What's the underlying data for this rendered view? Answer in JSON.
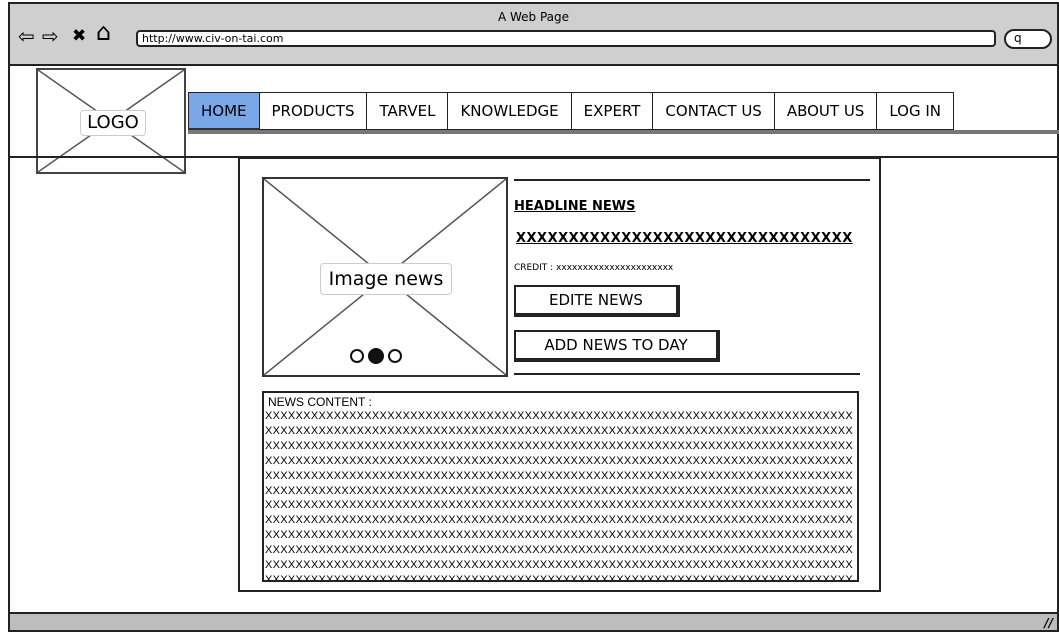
{
  "window": {
    "title": "A Web Page"
  },
  "toolbar": {
    "back_icon": "⇦",
    "forward_icon": "⇨",
    "stop_icon": "✖",
    "home_icon": "⌂",
    "url": "http://www.civ-on-tai.com",
    "search_icon_glyph": "q"
  },
  "logo": {
    "label": "LOGO"
  },
  "menu": {
    "items": [
      {
        "label": "HOME",
        "active": true
      },
      {
        "label": "PRODUCTS"
      },
      {
        "label": "TARVEL"
      },
      {
        "label": "KNOWLEDGE"
      },
      {
        "label": "EXPERT"
      },
      {
        "label": "CONTACT US"
      },
      {
        "label": "ABOUT US"
      },
      {
        "label": "LOG IN"
      }
    ],
    "active_color": "#7aa7e8"
  },
  "news": {
    "image_label": "Image news",
    "headline": "HEADLINE NEWS",
    "headline_text": "XXXXXXXXXXXXXXXXXXXXXXXXXXXXXXXX",
    "credit": "CREDIT : xxxxxxxxxxxxxxxxxxxxxx",
    "edit_button": "EDITE NEWS",
    "add_button": "ADD NEWS TO DAY",
    "carousel": {
      "count": 3,
      "active_index": 1
    },
    "content_title": "NEWS CONTENT :",
    "content_body": "XXXXXXXXXXXXXXXXXXXXXXXXXXXXXXXXXXXXXXXXXXXXXXXXXXXXXXXXXXXXXXXXXXXXXXXXXXXXXXXXXXXXXXXXXXXXXXXXXXXXXXXXXXXXXXXXXXXXXXXXXXXXXXXXXXXXXXXXXXXXXXXXXXXXXXXXXXXXXXXXXXXXXXXXXXXXXXXXXXXXXXXXXXXXXXXXXXXXXXXXXXXXXXXXXXXXXXXXXXXXXXXXXXXXXXXXXXXXXXXXXXXXXXXXXXXXXXXXXXXXXXXXXXXXXXXXXXXXXXXXXXXXXXXXXXXXXXXXXXXXXXXXXXXXXXXXXXXXXXXXXXXXXXXXXXXXXXXXXXXXXXXXXXXXXXXXXXXXXXXXXXXXXXXXXXXXXXXXXXXXXXXXXXXXXXXXXXXXXXXXXXXXXXXXXXXXXXXXXXXXXXXXXXXXXXXXXXXXXXXXXXXXXXXXXXXXXXXXXXXXXXXXXXXXXXXXXXXXXXXXXXXXXXXXXXXXXXXXXXXXXXXXXXXXXXXXXXXXXXXXXXXXXXXXXXXXXXXXXXXXXXXXXXXXXXXXXXXXXXXXXXXXXXXXXXXXXXXXXXXXXXXXXXXXXXXXXXXXXXXXXXXXXXXXXXXXXXXXXXXXXXXXXXXXXXXXXXXXXXXXXXXXXXXXXXXXXXXXXXXXXXXXXXXXXXXXXXXXXXXXXXXXXXXXXXXXXXXXXXXXXXXXXXXXXXXXXXXXXXXXXXXXXXXXXXXXXXXXXXXXXXXXXXXXXXXXXXXXXXXXXXXXXXXXXXXXXXXXXXXXXXXXXXXXXXXXXXXXXXXXXXXXXXXXXXXXXXXXXXXXXXXXXXXXXXXXXXXXXXXXXXXXXXXXXXXXXXXXXXXXXXXXXXXXXXXXXXXXXXXXXXXXXXXXXXXXXXXXXXXXXXXXXXXXXXXXXXXXXXXXXXXXXXXXXXXXXXXXXXXXXXXXXXXXXXXXXXXXXXXXXXXXXXXXXXXXXXXXXXXXXXXXXXXXXXXXXXXXXXXXXXXXXXXXXXXXXXXXXXXXXXXXXXXXXXXXXXXXXXXXXXXXXXXXXXXXXXXXXXX"
  },
  "statusbar": {
    "resize_glyph": "//"
  }
}
